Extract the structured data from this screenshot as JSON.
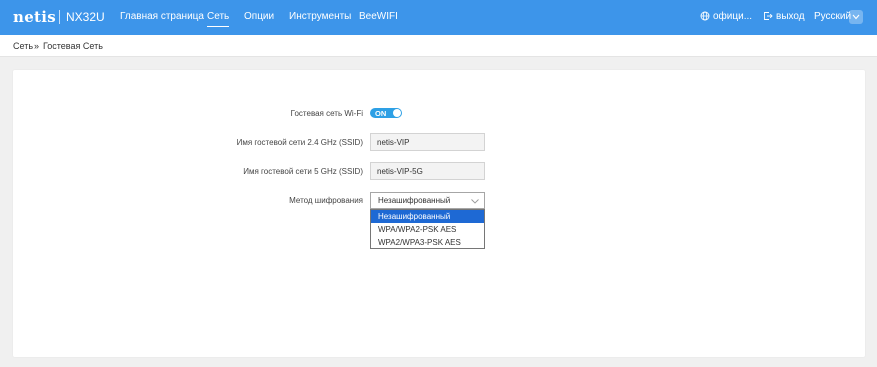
{
  "header": {
    "logo": "netis",
    "model": "NX32U",
    "nav": [
      {
        "label": "Главная страница"
      },
      {
        "label": "Сеть"
      },
      {
        "label": "Опции"
      },
      {
        "label": "Инструменты"
      },
      {
        "label": "BeeWIFI"
      }
    ],
    "active_nav": "Сеть",
    "official_label": "офици...",
    "logout_label": "выход",
    "language": "Русский"
  },
  "breadcrumb": {
    "parent": "Сеть",
    "separator": "»",
    "current": "Гостевая Сеть"
  },
  "form": {
    "guest_wifi_label": "Гостевая сеть Wi-Fi",
    "guest_wifi_toggle": "ON",
    "ssid_24_label": "Имя гостевой сети 2.4 GHz (SSID)",
    "ssid_24_value": "netis-VIP",
    "ssid_5_label": "Имя гостевой сети 5 GHz (SSID)",
    "ssid_5_value": "netis-VIP-5G",
    "encryption_label": "Метод шифрования",
    "encryption_value": "Незашифрованный",
    "encryption_options": [
      "Незашифрованный",
      "WPA/WPA2-PSK AES",
      "WPA2/WPA3-PSK AES"
    ]
  },
  "colors": {
    "header_bg": "#3d95ea",
    "toggle_on": "#2ea0e5",
    "option_selected": "#1e69d4"
  },
  "icons": {
    "official": "globe-icon",
    "logout": "logout-icon",
    "language": "chevron-down-icon",
    "select": "chevron-down-icon"
  }
}
